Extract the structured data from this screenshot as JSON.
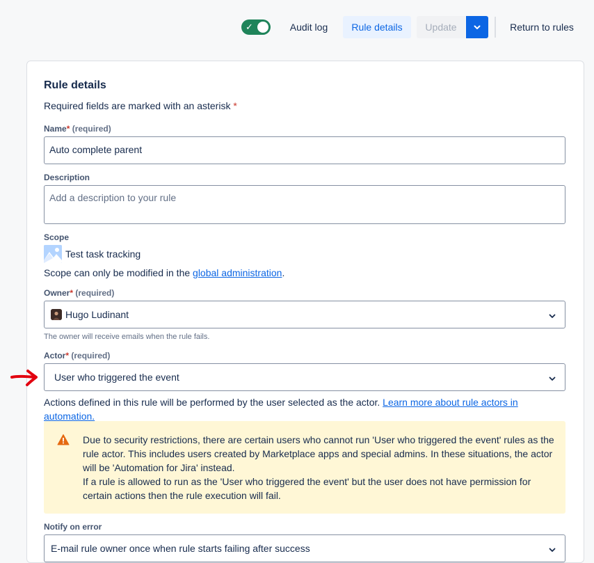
{
  "toolbar": {
    "audit_log": "Audit log",
    "rule_details": "Rule details",
    "update": "Update",
    "return_to_rules": "Return to rules",
    "toggle_state": "on",
    "accent": "#0c66e4",
    "toggle_color": "#1f845a"
  },
  "form": {
    "heading": "Rule details",
    "required_note": "Required fields are marked with an asterisk",
    "asterisk": "*",
    "name": {
      "label": "Name",
      "required": "(required)",
      "value": "Auto complete parent"
    },
    "description": {
      "label": "Description",
      "placeholder": "Add a description to your rule"
    },
    "scope": {
      "label": "Scope",
      "value": "Test task tracking",
      "note_prefix": "Scope can only be modified in the",
      "note_link": "global administration",
      "note_suffix": "."
    },
    "owner": {
      "label": "Owner",
      "required": "(required)",
      "value": "Hugo Ludinant",
      "help": "The owner will receive emails when the rule fails."
    },
    "actor": {
      "label": "Actor",
      "required": "(required)",
      "value": "User who triggered the event",
      "help_text": "Actions defined in this rule will be performed by the user selected as the actor.",
      "help_link_line1": "Learn more about rule actors in",
      "help_link_line2": "automation."
    },
    "warning": {
      "line1": "Due to security restrictions, there are certain users who cannot run 'User who triggered the event' rules as the",
      "line2": "rule actor. This includes users created by Marketplace apps and special admins. In these situations, the actor",
      "line3": "will be 'Automation for Jira' instead.",
      "line4": "If a rule is allowed to run as the 'User who triggered the event' but the user does not have permission for",
      "line5": "certain actions then the rule execution will fail.",
      "color": "#fff7d6"
    },
    "notify": {
      "label": "Notify on error",
      "value": "E-mail rule owner once when rule starts failing after success"
    }
  },
  "annotation": {
    "arrow_color": "#e2000f"
  }
}
